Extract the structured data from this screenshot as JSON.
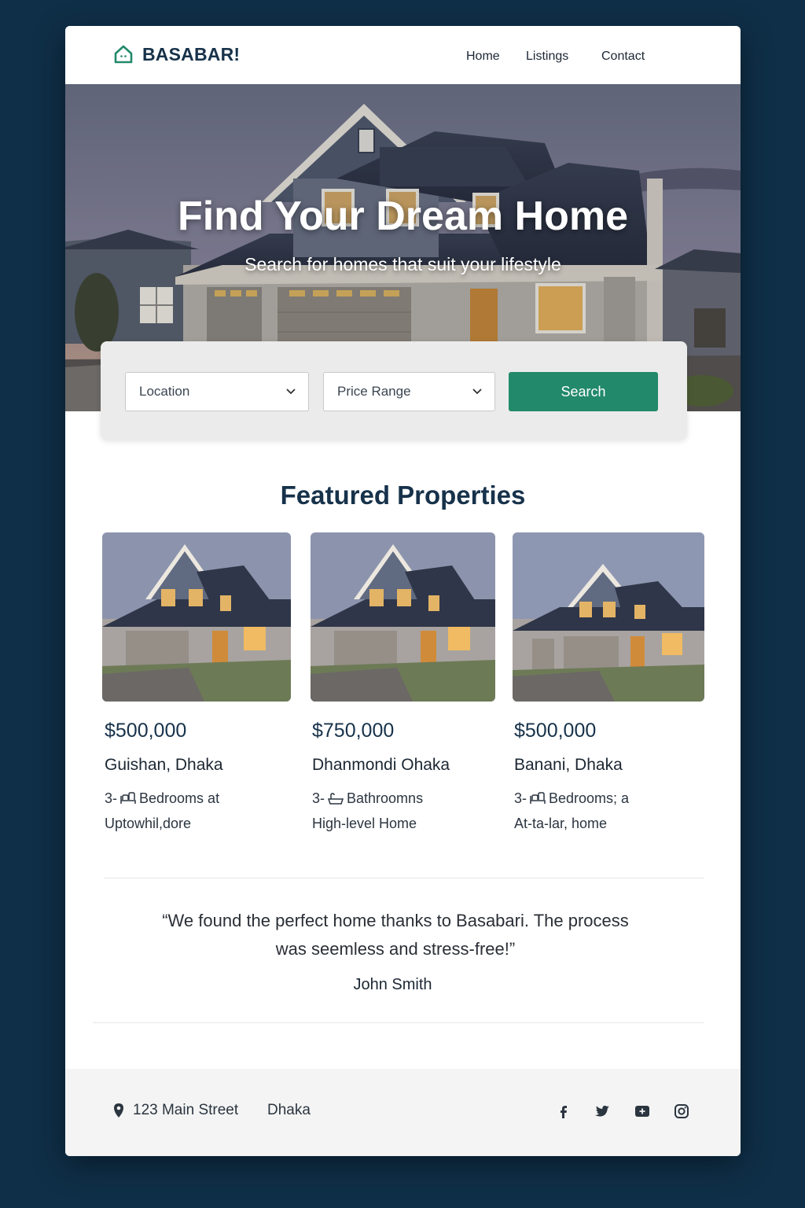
{
  "header": {
    "brand": "BASABAR!",
    "nav": [
      "Home",
      "Listings",
      "Contact"
    ]
  },
  "hero": {
    "title": "Find Your Dream Home",
    "subtitle": "Search for homes that suit your lifestyle"
  },
  "search": {
    "location_label": "Location",
    "price_label": "Price Range",
    "button_label": "Search"
  },
  "featured": {
    "title": "Featured Properties",
    "cards": [
      {
        "price": "$500,000",
        "location": "Guishan, Dhaka",
        "line1_prefix": "3-",
        "line1_text": "Bedrooms at",
        "line2": "Uptowhil,dore"
      },
      {
        "price": "$750,000",
        "location": "Dhanmondi Ohaka",
        "line1_prefix": "3-",
        "line1_text": "Bathroomns",
        "line2": "High-level Home"
      },
      {
        "price": "$500,000",
        "location": "Banani, Dhaka",
        "line1_prefix": "3-",
        "line1_text": "Bedrooms; a",
        "line2": "At-ta-lar, home"
      }
    ]
  },
  "testimonial": {
    "quote": "“We found the perfect home thanks to Basabari. The process was seemless and stress-free!”",
    "author": "John Smith"
  },
  "footer": {
    "address": "123 Main Street",
    "city": "Dhaka",
    "social_icons": [
      "facebook-icon",
      "twitter-icon",
      "youtube-icon",
      "instagram-icon"
    ]
  },
  "colors": {
    "background": "#0f2f48",
    "brand": "#17324a",
    "accent": "#22896a"
  }
}
